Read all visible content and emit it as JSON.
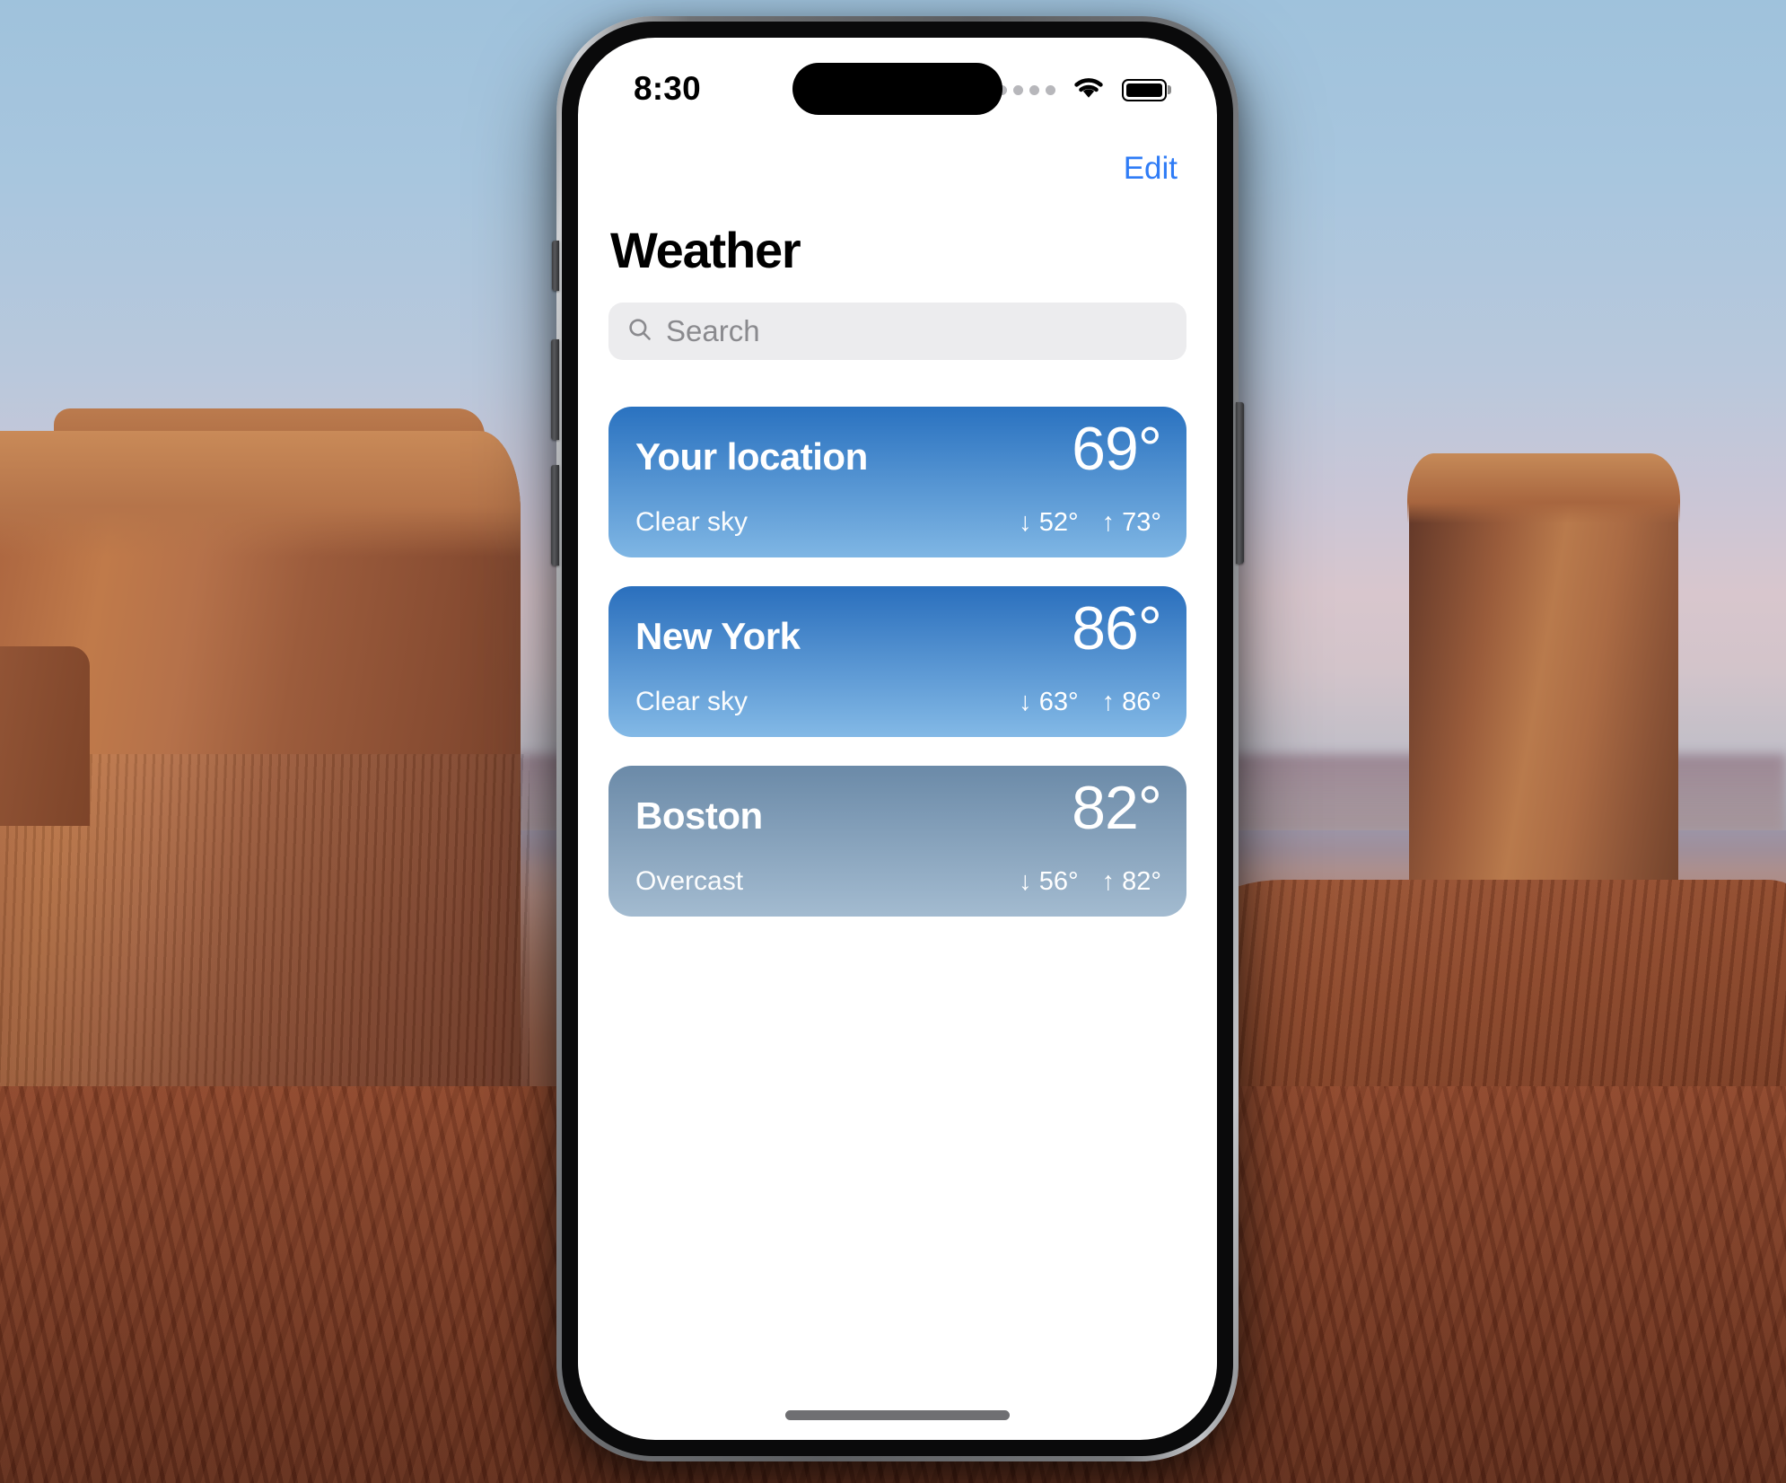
{
  "wallpaper": {
    "scene": "desert-mesa-sunrise",
    "sky_color": "#a8c6de",
    "rock_color": "#a8603c"
  },
  "status_bar": {
    "time": "8:30",
    "cellular_icon": "cellular-dots-icon",
    "wifi_icon": "wifi-icon",
    "battery_icon": "battery-icon",
    "battery_level_percent": 100
  },
  "nav": {
    "edit_label": "Edit"
  },
  "header": {
    "title": "Weather"
  },
  "search": {
    "placeholder": "Search",
    "value": "",
    "icon": "search-icon"
  },
  "colors": {
    "accent": "#2f7cf6",
    "search_bg": "#ececee",
    "search_text": "#8a8a8e",
    "card_clear_top": "#2a72c0",
    "card_clear_bottom": "#7fb6e4",
    "card_overcast_top": "#6b8aa8",
    "card_overcast_bottom": "#a3bbd0"
  },
  "cities": [
    {
      "name": "Your location",
      "condition": "Clear sky",
      "temperature": "69°",
      "low": "↓ 52°",
      "high": "↑ 73°",
      "gradient_top": "#2a72c0",
      "gradient_bottom": "#7fb6e4"
    },
    {
      "name": "New York",
      "condition": "Clear sky",
      "temperature": "86°",
      "low": "↓ 63°",
      "high": "↑ 86°",
      "gradient_top": "#2a6fbd",
      "gradient_bottom": "#83b9e6"
    },
    {
      "name": "Boston",
      "condition": "Overcast",
      "temperature": "82°",
      "low": "↓ 56°",
      "high": "↑ 82°",
      "gradient_top": "#6b8aa8",
      "gradient_bottom": "#a3bbd0"
    }
  ],
  "home_indicator": "home-indicator"
}
